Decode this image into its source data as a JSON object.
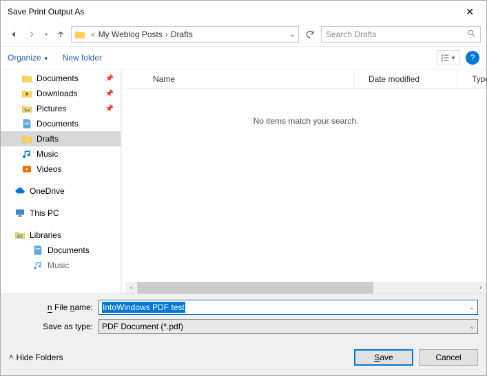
{
  "title": "Save Print Output As",
  "breadcrumb": {
    "sep": "«",
    "seg1": "My Weblog Posts",
    "seg2": "Drafts"
  },
  "search": {
    "placeholder": "Search Drafts"
  },
  "toolbar": {
    "organize": "Organize",
    "new_folder": "New folder"
  },
  "tree": {
    "documents": "Documents",
    "downloads": "Downloads",
    "pictures": "Pictures",
    "documents2": "Documents",
    "drafts": "Drafts",
    "music": "Music",
    "videos": "Videos",
    "onedrive": "OneDrive",
    "thispc": "This PC",
    "libraries": "Libraries",
    "lib_documents": "Documents",
    "lib_music": "Music"
  },
  "columns": {
    "name": "Name",
    "date": "Date modified",
    "type": "Type"
  },
  "empty": "No items match your search.",
  "form": {
    "filename_label": "File name:",
    "filename_value": "IntoWindows PDF test",
    "type_label": "Save as type:",
    "type_value": "PDF Document (*.pdf)"
  },
  "footer": {
    "hide_folders": "Hide Folders",
    "save": "Save",
    "save_ul": "S",
    "save_rest": "ave",
    "cancel": "Cancel"
  }
}
